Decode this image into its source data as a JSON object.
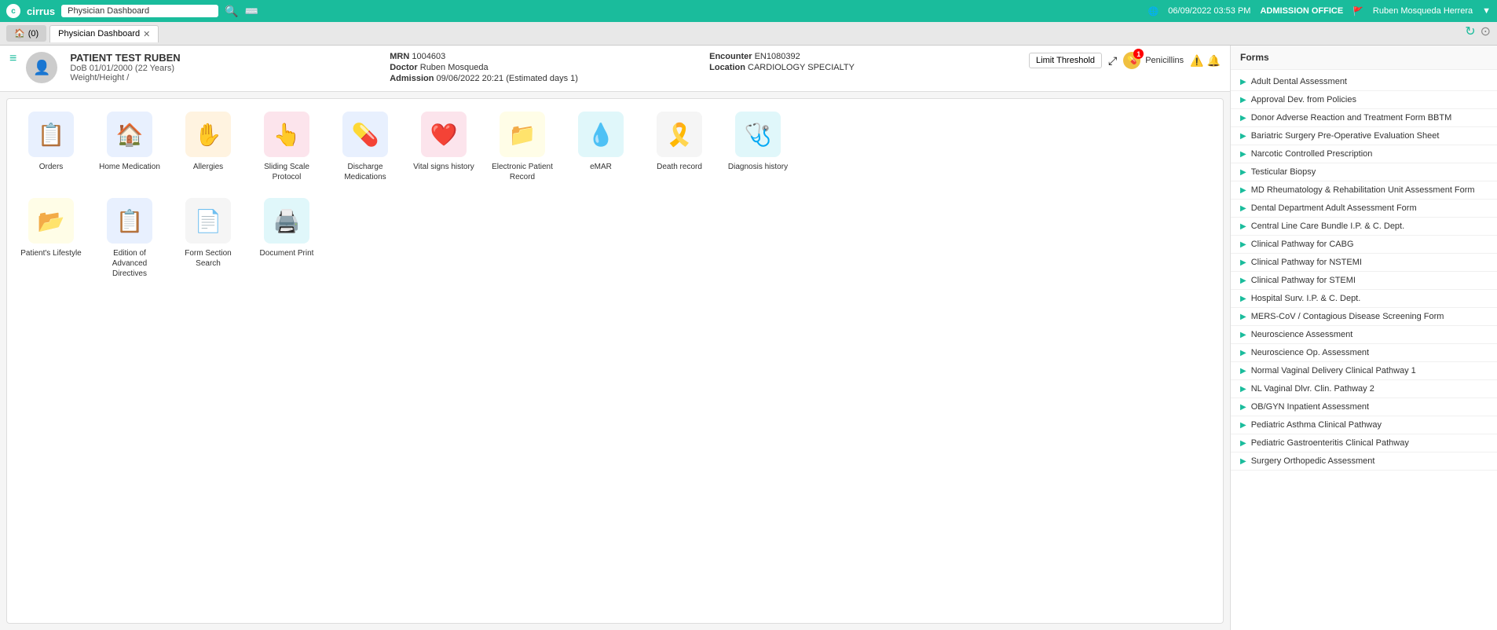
{
  "topNav": {
    "logo": "cirrus",
    "pageTitle": "Physician Dashboard",
    "datetime": "06/09/2022 03:53 PM",
    "office": "ADMISSION OFFICE",
    "user": "Ruben Mosqueda Herrera"
  },
  "tabs": {
    "homeTab": {
      "label": "(0)",
      "icon": "🏠"
    },
    "activeTab": {
      "label": "Physician Dashboard"
    }
  },
  "patient": {
    "name": "PATIENT TEST RUBEN",
    "gender": "♂",
    "dob": "DoB  01/01/2000 (22 Years)",
    "weightHeight": "Weight/Height  /",
    "mrn": {
      "label": "MRN",
      "value": "1004603"
    },
    "doctor": {
      "label": "Doctor",
      "value": "Ruben Mosqueda"
    },
    "admission": {
      "label": "Admission",
      "value": "09/06/2022 20:21 (Estimated days 1)"
    },
    "encounter": {
      "label": "Encounter",
      "value": "EN1080392"
    },
    "location": {
      "label": "Location",
      "value": "CARDIOLOGY SPECIALTY"
    },
    "limitThreshold": "Limit Threshold",
    "allergyLabel": "Penicillins",
    "allergyCount": "1"
  },
  "icons": {
    "row1": [
      {
        "label": "Orders",
        "emoji": "📋",
        "colorClass": "icon-blue"
      },
      {
        "label": "Home Medication",
        "emoji": "🏠",
        "colorClass": "icon-blue"
      },
      {
        "label": "Allergies",
        "emoji": "✋",
        "colorClass": "icon-orange"
      },
      {
        "label": "Sliding Scale Protocol",
        "emoji": "👆",
        "colorClass": "icon-pink"
      },
      {
        "label": "Discharge Medications",
        "emoji": "💊",
        "colorClass": "icon-blue"
      },
      {
        "label": "Vital signs history",
        "emoji": "❤️",
        "colorClass": "icon-pink"
      },
      {
        "label": "Electronic Patient Record",
        "emoji": "📁",
        "colorClass": "icon-yellow"
      },
      {
        "label": "eMAR",
        "emoji": "💧",
        "colorClass": "icon-teal"
      },
      {
        "label": "Death record",
        "emoji": "🎗️",
        "colorClass": "icon-gray"
      },
      {
        "label": "Diagnosis history",
        "emoji": "🩺",
        "colorClass": "icon-dark-teal"
      }
    ],
    "row2": [
      {
        "label": "Patient's Lifestyle",
        "emoji": "📂",
        "colorClass": "icon-yellow"
      },
      {
        "label": "Edition of Advanced Directives",
        "emoji": "📋",
        "colorClass": "icon-blue"
      },
      {
        "label": "Form Section Search",
        "emoji": "📄",
        "colorClass": "icon-gray"
      },
      {
        "label": "Document Print",
        "emoji": "🖨️",
        "colorClass": "icon-teal"
      }
    ]
  },
  "forms": {
    "header": "Forms",
    "items": [
      "Adult Dental Assessment",
      "Approval Dev. from Policies",
      "Donor Adverse Reaction and Treatment Form BBTM",
      "Bariatric Surgery Pre-Operative Evaluation Sheet",
      "Narcotic Controlled Prescription",
      "Testicular Biopsy",
      "MD Rheumatology & Rehabilitation Unit Assessment Form",
      "Dental Department Adult Assessment Form",
      "Central Line Care Bundle I.P. & C. Dept.",
      "Clinical Pathway for CABG",
      "Clinical Pathway for NSTEMI",
      "Clinical Pathway for STEMI",
      "Hospital Surv. I.P. & C. Dept.",
      "MERS-CoV / Contagious Disease Screening Form",
      "Neuroscience Assessment",
      "Neuroscience Op. Assessment",
      "Normal Vaginal Delivery Clinical Pathway 1",
      "NL Vaginal Dlvr. Clin. Pathway 2",
      "OB/GYN Inpatient Assessment",
      "Pediatric Asthma Clinical Pathway",
      "Pediatric Gastroenteritis Clinical Pathway",
      "Surgery Orthopedic Assessment"
    ]
  }
}
